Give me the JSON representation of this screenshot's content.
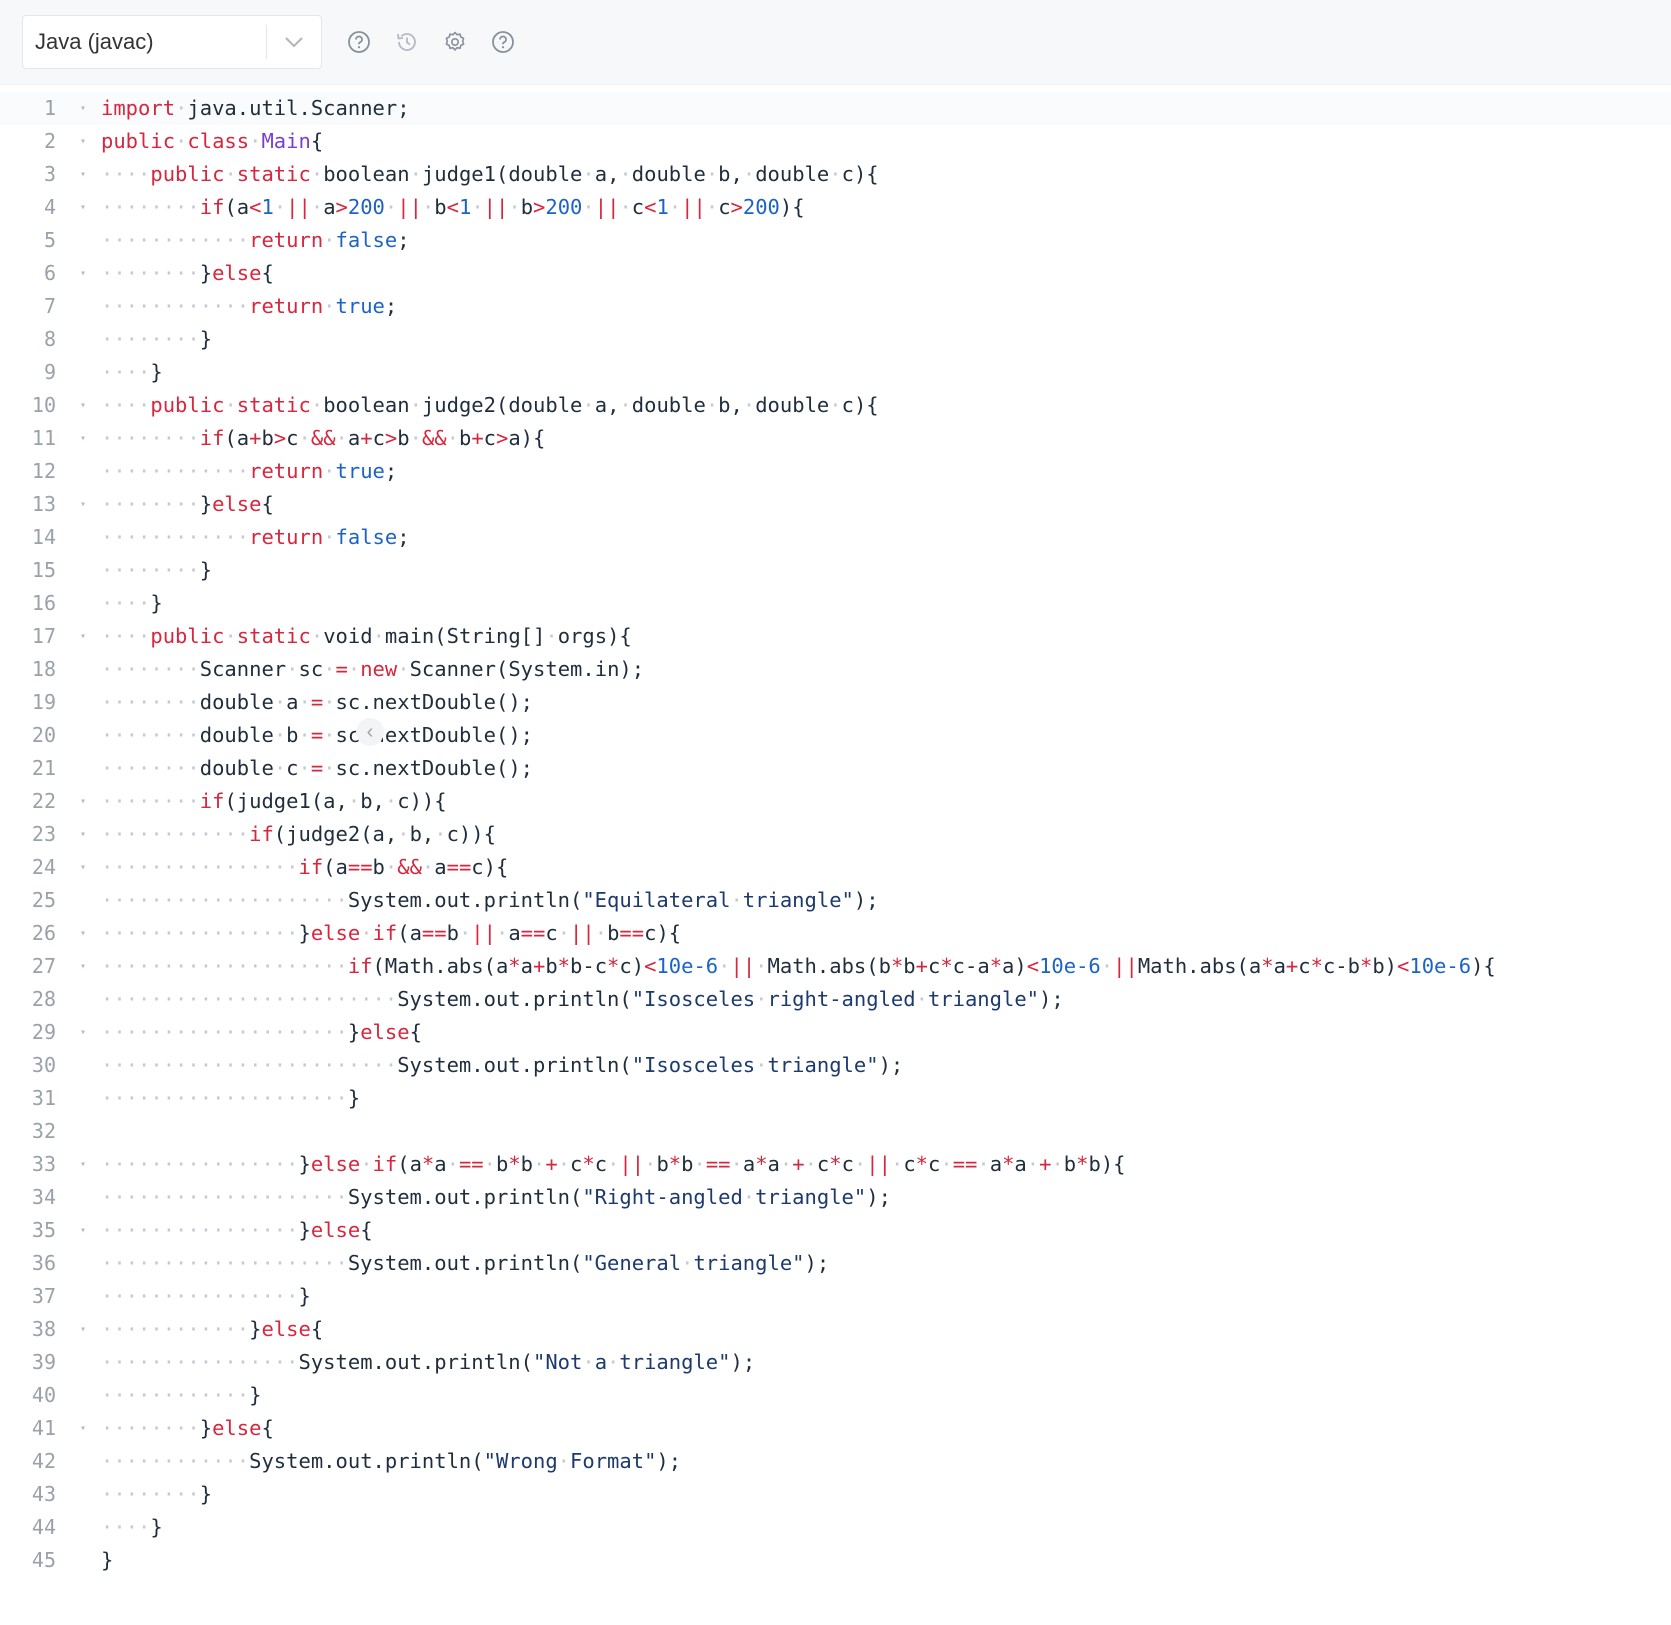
{
  "toolbar": {
    "language": "Java (javac)",
    "icons": [
      "help-circle-icon",
      "history-icon",
      "settings-gear-icon",
      "help-circle-icon"
    ]
  },
  "colors": {
    "keyword": "#d7263d",
    "number": "#1c63c7",
    "type": "#7a3fd1",
    "string": "#1c3a6e",
    "text": "#1f2d3d"
  },
  "editor": {
    "language": "java",
    "folding_lines": [
      1,
      2,
      3,
      4,
      6,
      10,
      11,
      13,
      17,
      22,
      23,
      24,
      26,
      27,
      29,
      33,
      35,
      38,
      41
    ],
    "lines": [
      "import java.util.Scanner;",
      "public class Main{",
      "    public static boolean judge1(double a, double b, double c){",
      "        if(a<1 || a>200 || b<1 || b>200 || c<1 || c>200){",
      "            return false;",
      "        }else{",
      "            return true;",
      "        }",
      "    }",
      "    public static boolean judge2(double a, double b, double c){",
      "        if(a+b>c && a+c>b && b+c>a){",
      "            return true;",
      "        }else{",
      "            return false;",
      "        }",
      "    }",
      "    public static void main(String[] orgs){",
      "        Scanner sc = new Scanner(System.in);",
      "        double a = sc.nextDouble();",
      "        double b = sc.nextDouble();",
      "        double c = sc.nextDouble();",
      "        if(judge1(a, b, c)){",
      "            if(judge2(a, b, c)){",
      "                if(a==b && a==c){",
      "                    System.out.println(\"Equilateral triangle\");",
      "                }else if(a==b || a==c || b==c){",
      "                    if(Math.abs(a*a+b*b-c*c)<10e-6 || Math.abs(b*b+c*c-a*a)<10e-6 ||Math.abs(a*a+c*c-b*b)<10e-6){",
      "                        System.out.println(\"Isosceles right-angled triangle\");",
      "                    }else{",
      "                        System.out.println(\"Isosceles triangle\");",
      "                    }",
      "",
      "                }else if(a*a == b*b + c*c || b*b == a*a + c*c || c*c == a*a + b*b){",
      "                    System.out.println(\"Right-angled triangle\");",
      "                }else{",
      "                    System.out.println(\"General triangle\");",
      "                }",
      "            }else{",
      "                System.out.println(\"Not a triangle\");",
      "            }",
      "        }else{",
      "            System.out.println(\"Wrong Format\");",
      "        }",
      "    }",
      "}"
    ]
  }
}
